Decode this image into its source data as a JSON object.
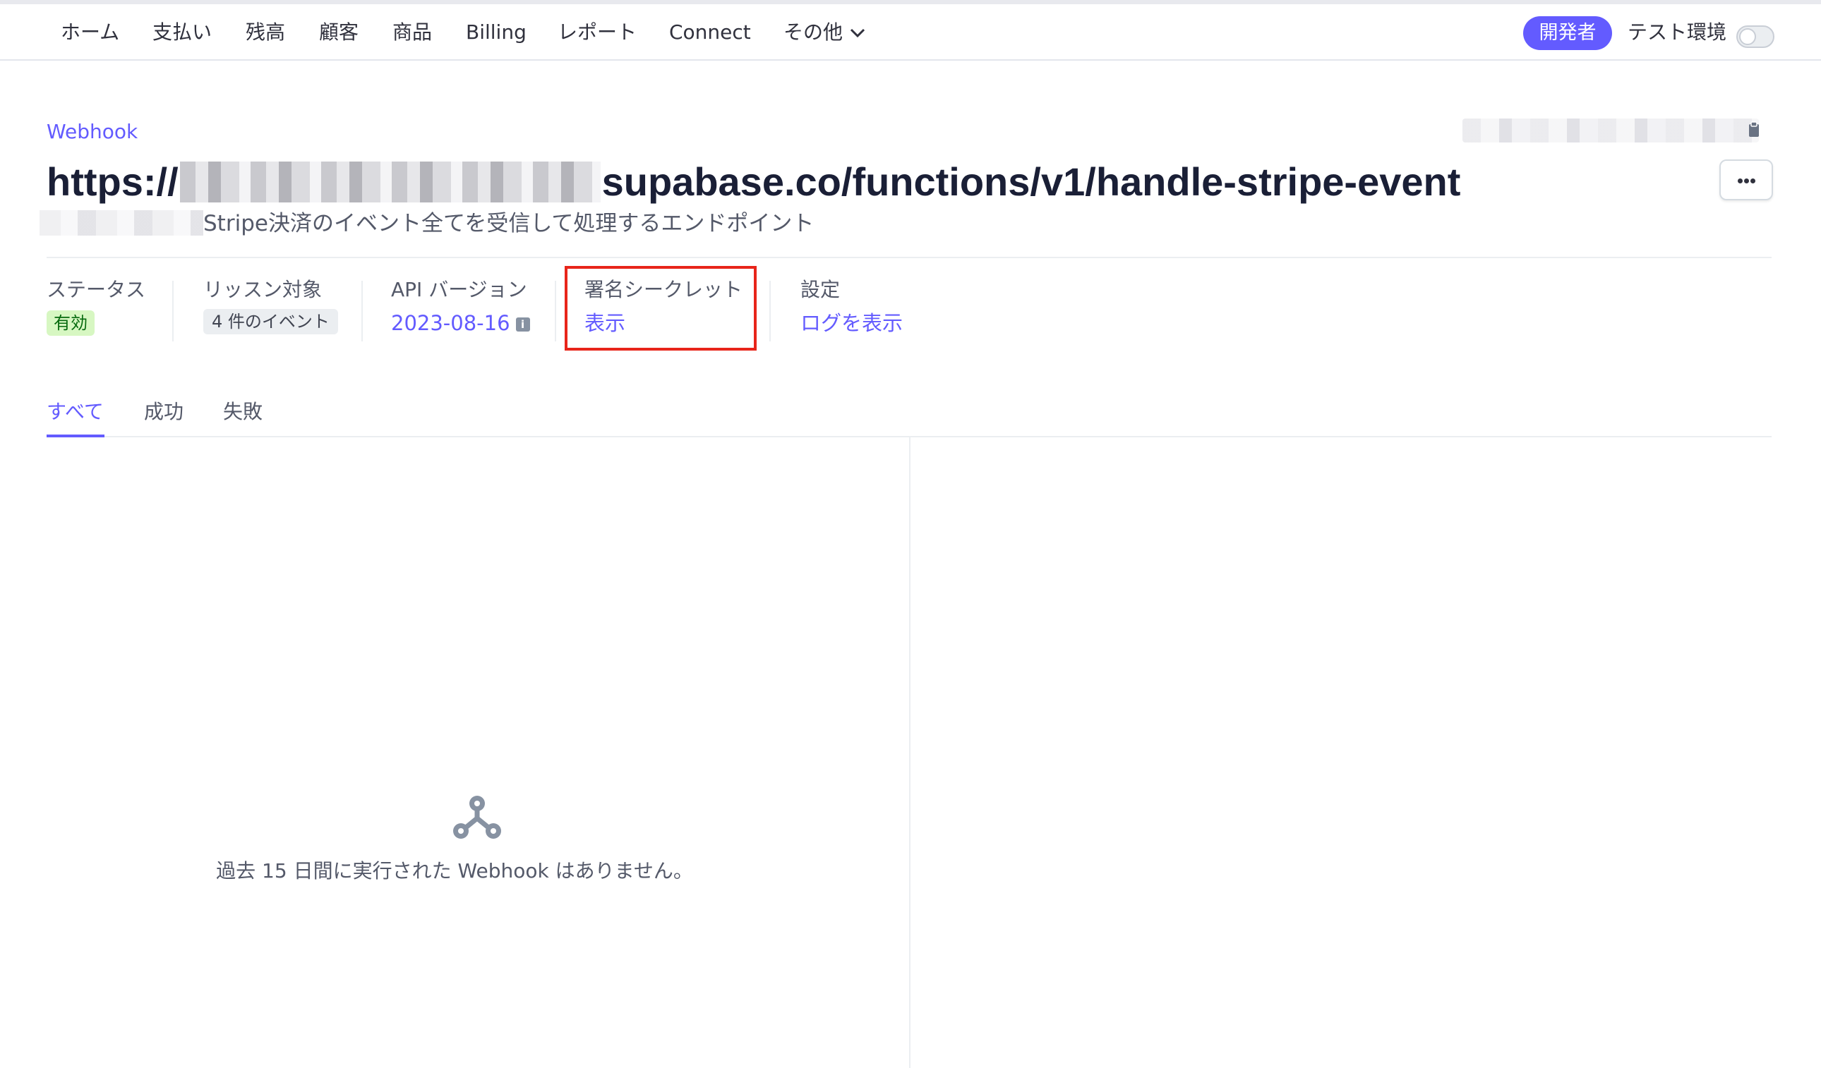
{
  "nav": {
    "items": [
      "ホーム",
      "支払い",
      "残高",
      "顧客",
      "商品",
      "Billing",
      "レポート",
      "Connect",
      "その他"
    ],
    "developer_badge": "開発者",
    "test_mode_label": "テスト環境",
    "test_mode_on": false
  },
  "breadcrumb": "Webhook",
  "endpoint": {
    "url_prefix": "https://",
    "url_suffix": "supabase.co/functions/v1/handle-stripe-event",
    "description": "Stripe決済のイベント全てを受信して処理するエンドポイント"
  },
  "meta": {
    "status_label": "ステータス",
    "status_value": "有効",
    "listening_label": "リッスン対象",
    "listening_value": "4 件のイベント",
    "api_version_label": "API バージョン",
    "api_version_value": "2023-08-16",
    "secret_label": "署名シークレット",
    "secret_action": "表示",
    "settings_label": "設定",
    "settings_action": "ログを表示"
  },
  "tabs": [
    "すべて",
    "成功",
    "失敗"
  ],
  "active_tab": "すべて",
  "empty_state": "過去 15 日間に実行された Webhook はありません。",
  "colors": {
    "accent": "#635bff",
    "status_green_bg": "#d7f7c2",
    "highlight_red": "#e8251a"
  }
}
